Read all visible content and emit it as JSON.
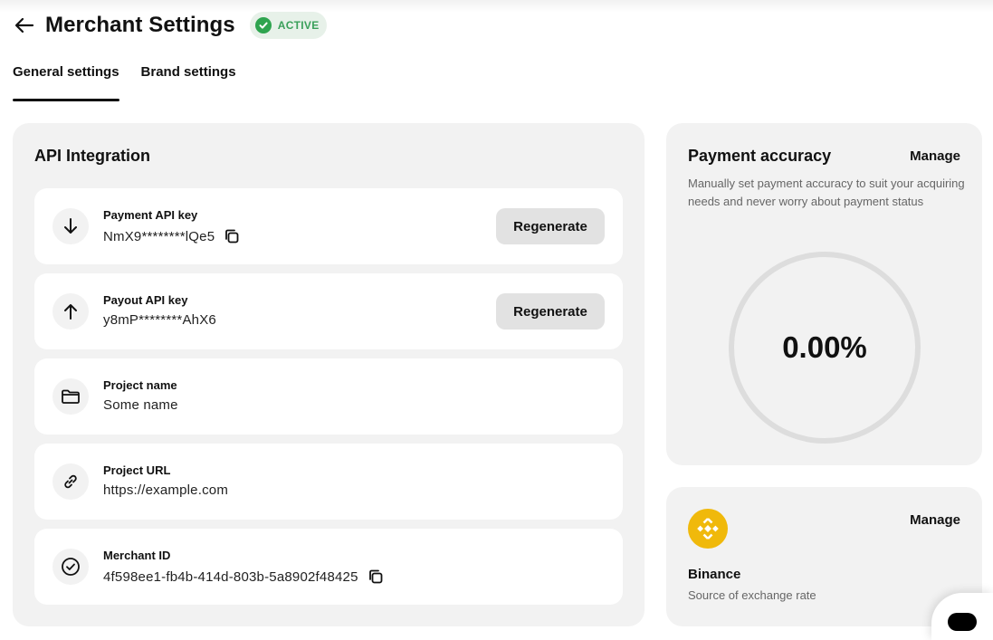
{
  "header": {
    "title": "Merchant Settings",
    "status": "ACTIVE"
  },
  "tabs": [
    {
      "label": "General settings",
      "active": true
    },
    {
      "label": "Brand settings",
      "active": false
    }
  ],
  "api_integration": {
    "title": "API Integration",
    "regenerate_label": "Regenerate",
    "rows": [
      {
        "icon": "arrow-down-icon",
        "label": "Payment API key",
        "value": "NmX9********lQe5"
      },
      {
        "icon": "arrow-up-icon",
        "label": "Payout API key",
        "value": "y8mP********AhX6"
      },
      {
        "icon": "folder-icon",
        "label": "Project name",
        "value": "Some name"
      },
      {
        "icon": "link-icon",
        "label": "Project URL",
        "value": "https://example.com"
      },
      {
        "icon": "check-circle-icon",
        "label": "Merchant ID",
        "value": "4f598ee1-fb4b-414d-803b-5a8902f48425"
      }
    ]
  },
  "payment_accuracy": {
    "title": "Payment accuracy",
    "manage_label": "Manage",
    "description": "Manually set payment accuracy to suit your acquiring needs and never worry about payment status",
    "value": "0.00%",
    "progress_fraction": 0
  },
  "exchange_source": {
    "name": "Binance",
    "subtitle": "Source of exchange rate",
    "manage_label": "Manage",
    "logo_color": "#f0b90b"
  },
  "colors": {
    "accent_active": "#2ea44f",
    "card_background": "#f2f2f2"
  }
}
